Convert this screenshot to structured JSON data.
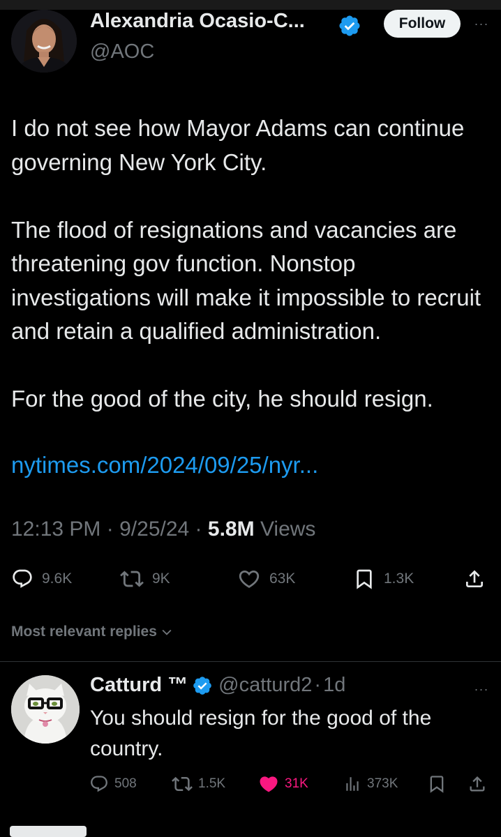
{
  "tweet": {
    "author_name": "Alexandria Ocasio-C...",
    "author_handle": "@AOC",
    "follow_label": "Follow",
    "more_label": "···",
    "paragraphs": [
      "I do not see how Mayor Adams can continue governing New York City.",
      "The flood of resignations and vacancies are threatening gov function. Nonstop investigations will make it impossible to recruit and retain a qualified administration.",
      "For the good of the city, he should resign."
    ],
    "link": "nytimes.com/2024/09/25/nyr...",
    "time": "12:13 PM",
    "separator": "·",
    "date": "9/25/24",
    "views_count": "5.8M",
    "views_label": "Views",
    "actions": {
      "replies": "9.6K",
      "reposts": "9K",
      "likes": "63K",
      "bookmarks": "1.3K"
    }
  },
  "replies_filter": {
    "label": "Most relevant replies"
  },
  "reply": {
    "author_name": "Catturd ™",
    "author_handle": "@catturd2",
    "separator": "·",
    "age": "1d",
    "more_label": "···",
    "text": "You should resign for the good of the country.",
    "actions": {
      "replies": "508",
      "reposts": "1.5K",
      "likes": "31K",
      "views": "373K"
    }
  },
  "colors": {
    "background": "#000000",
    "text": "#e7e9ea",
    "muted": "#71767b",
    "link": "#1d9bf0",
    "like_active": "#f91880",
    "verified": "#1d9bf0"
  }
}
